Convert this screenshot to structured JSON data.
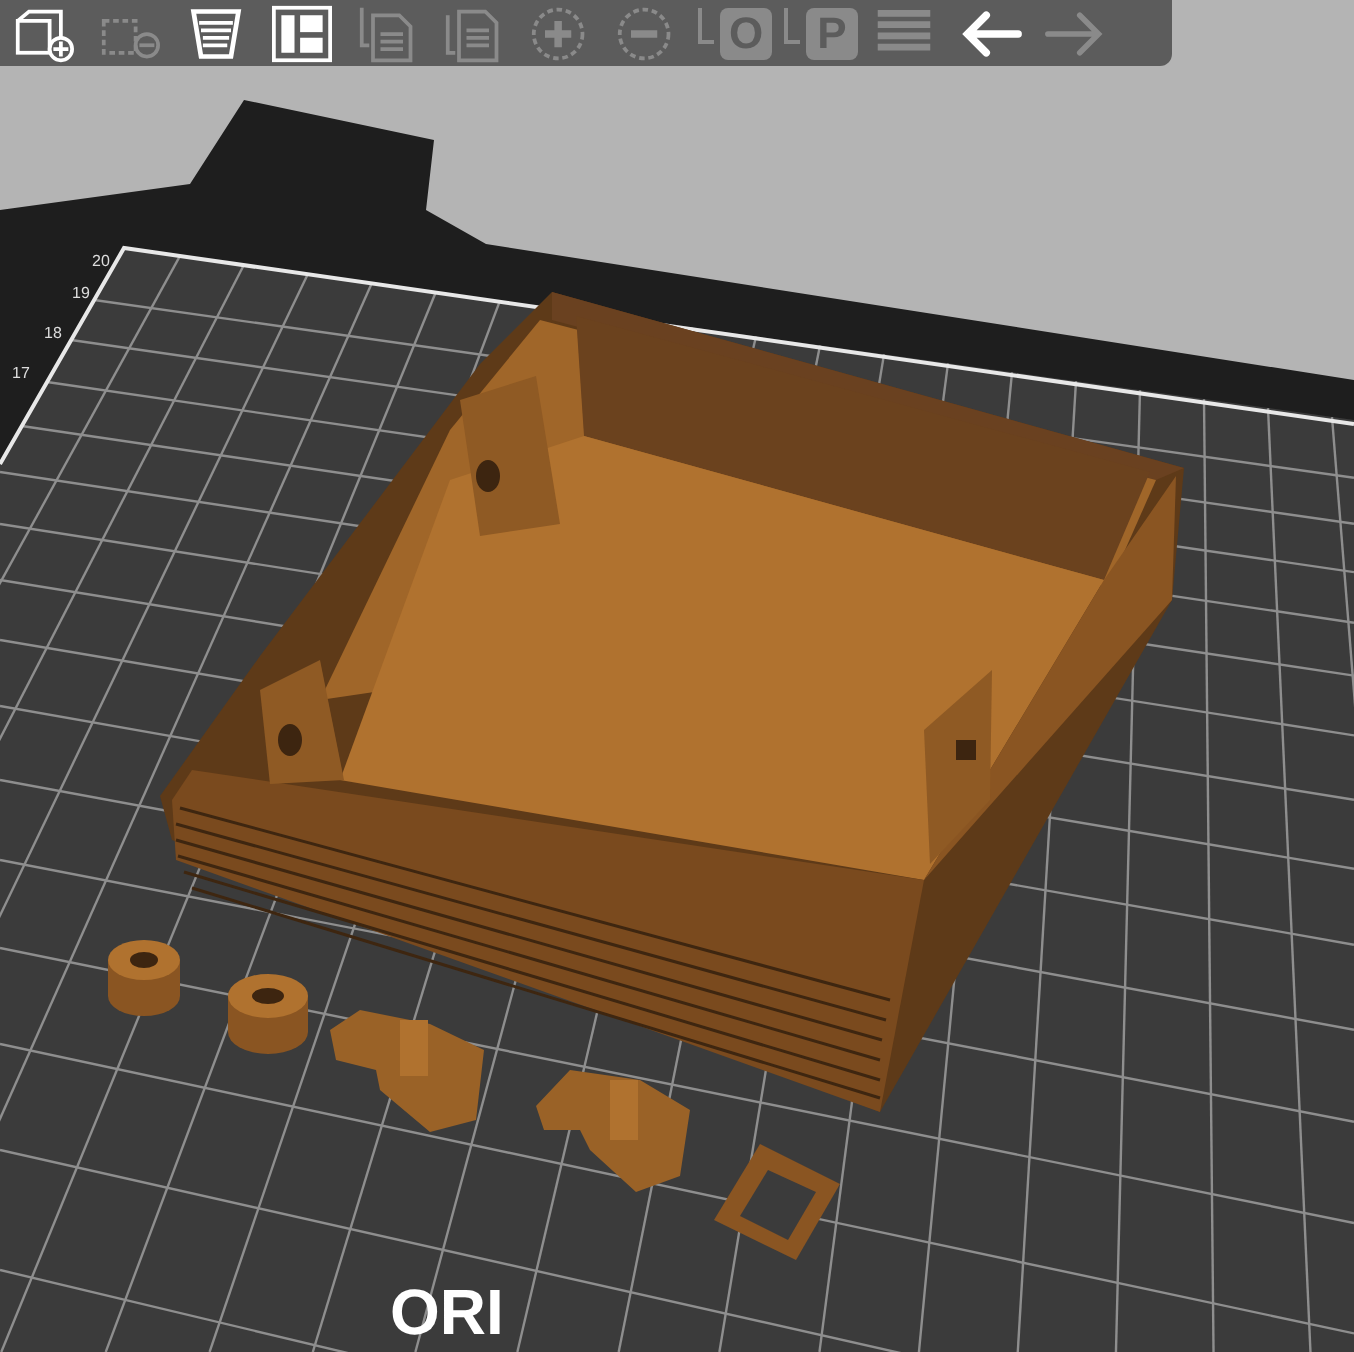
{
  "toolbar": {
    "tools": [
      {
        "kind": "add",
        "disabled": false
      },
      {
        "kind": "delete",
        "disabled": true
      },
      {
        "kind": "delete_all",
        "disabled": false
      },
      {
        "kind": "arrange",
        "disabled": false
      },
      {
        "kind": "copy",
        "disabled": true
      },
      {
        "kind": "paste",
        "disabled": true
      },
      {
        "kind": "add_instance",
        "disabled": true
      },
      {
        "kind": "remove_instance",
        "disabled": true
      },
      {
        "kind": "letter",
        "glyph": "O",
        "disabled": true
      },
      {
        "kind": "letter",
        "glyph": "P",
        "disabled": true
      },
      {
        "kind": "layers",
        "disabled": true
      },
      {
        "kind": "undo",
        "disabled": false
      },
      {
        "kind": "redo",
        "disabled": true
      }
    ]
  },
  "bed": {
    "ruler_labels": [
      "20",
      "19",
      "18",
      "17"
    ],
    "logo_text": "ORI"
  }
}
